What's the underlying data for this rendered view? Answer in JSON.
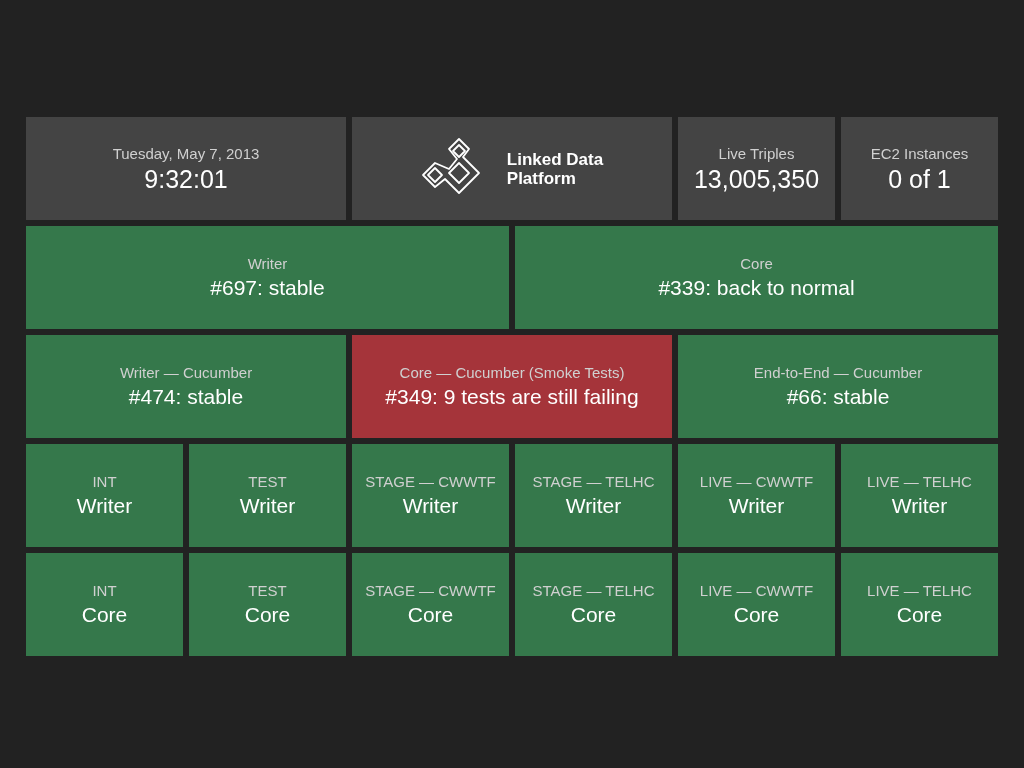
{
  "header": {
    "date": "Tuesday, May 7, 2013",
    "time": "9:32:01",
    "logo_lines": [
      "Linked Data",
      "Platform"
    ],
    "stats": [
      {
        "label": "Live Triples",
        "value": "13,005,350"
      },
      {
        "label": "EC2 Instances",
        "value": "0 of 1"
      }
    ]
  },
  "rows": [
    [
      {
        "label": "Writer",
        "value": "#697: stable",
        "failing": false
      },
      {
        "label": "Core",
        "value": "#339: back to normal",
        "failing": false
      }
    ],
    [
      {
        "label": "Writer — Cucumber",
        "value": "#474: stable",
        "failing": false
      },
      {
        "label": "Core — Cucumber (Smoke Tests)",
        "value": "#349: 9 tests are still failing",
        "failing": true
      },
      {
        "label": "End-to-End — Cucumber",
        "value": "#66: stable",
        "failing": false
      }
    ],
    [
      {
        "label": "INT",
        "value": "Writer",
        "failing": false
      },
      {
        "label": "TEST",
        "value": "Writer",
        "failing": false
      },
      {
        "label": "STAGE — CWWTF",
        "value": "Writer",
        "failing": false
      },
      {
        "label": "STAGE — TELHC",
        "value": "Writer",
        "failing": false
      },
      {
        "label": "LIVE — CWWTF",
        "value": "Writer",
        "failing": false
      },
      {
        "label": "LIVE — TELHC",
        "value": "Writer",
        "failing": false
      }
    ],
    [
      {
        "label": "INT",
        "value": "Core",
        "failing": false
      },
      {
        "label": "TEST",
        "value": "Core",
        "failing": false
      },
      {
        "label": "STAGE — CWWTF",
        "value": "Core",
        "failing": false
      },
      {
        "label": "STAGE — TELHC",
        "value": "Core",
        "failing": false
      },
      {
        "label": "LIVE — CWWTF",
        "value": "Core",
        "failing": false
      },
      {
        "label": "LIVE — TELHC",
        "value": "Core",
        "failing": false
      }
    ]
  ]
}
